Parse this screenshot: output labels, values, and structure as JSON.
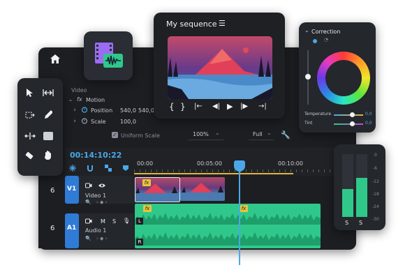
{
  "effects": {
    "section_label": "Video",
    "group_label": "Motion",
    "position": {
      "label": "Position",
      "x": "540,0",
      "y": "540,0"
    },
    "scale": {
      "label": "Scale",
      "value": "100,0"
    },
    "uniform_scale": {
      "label": "Uniform Scale",
      "checked": true
    }
  },
  "zoom": {
    "value": "100%",
    "options": [
      "100%"
    ]
  },
  "quality": {
    "value": "Full",
    "options": [
      "Full"
    ]
  },
  "timeline": {
    "timecode": "00:14:10:22",
    "ruler": [
      "00:00",
      "00:05:00",
      "00:10:00"
    ],
    "playhead_fraction": 0.55
  },
  "tracks": {
    "video": {
      "number": "6",
      "id": "V1",
      "name": "Video 1"
    },
    "audio": {
      "number": "6",
      "id": "A1",
      "name": "Audio 1",
      "mute": "M",
      "solo": "S",
      "left": "L",
      "right": "R"
    }
  },
  "clips": {
    "fx_label": "fx"
  },
  "monitor": {
    "title": "My sequence"
  },
  "correction": {
    "title": "Correction",
    "sliders": [
      {
        "label": "Temperature",
        "value": "0,0",
        "fraction": 0.62
      },
      {
        "label": "Tint",
        "value": "0,0",
        "fraction": 0.62
      }
    ]
  },
  "meters": {
    "scale": [
      "0",
      "-6",
      "-12",
      "-18",
      "-24",
      "-30"
    ],
    "solo_labels": [
      "S",
      "S"
    ],
    "levels": [
      0.45,
      0.62
    ]
  },
  "colors": {
    "panel": "#1b1d21",
    "panel_alt": "#23262c",
    "accent_blue": "#4aa8e8",
    "track_blue": "#2f7bd6",
    "audio_green": "#2fc88a",
    "fx_yellow": "#e6c53a",
    "ruler_yellow": "#e0b43a"
  }
}
